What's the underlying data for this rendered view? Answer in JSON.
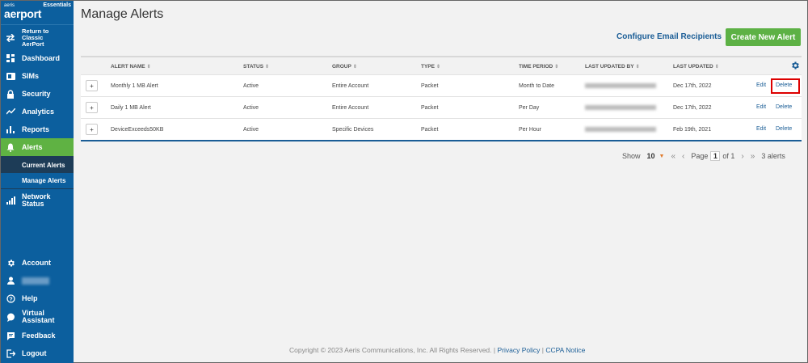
{
  "brand": {
    "small": "aeris",
    "name": "aerport",
    "edition": "Essentials"
  },
  "sidebar": {
    "items": [
      {
        "label": "Return to Classic AerPort",
        "icon": "swap-arrows-icon"
      },
      {
        "label": "Dashboard",
        "icon": "dashboard-icon"
      },
      {
        "label": "SIMs",
        "icon": "sim-icon"
      },
      {
        "label": "Security",
        "icon": "lock-icon"
      },
      {
        "label": "Analytics",
        "icon": "trend-icon"
      },
      {
        "label": "Reports",
        "icon": "bar-chart-icon"
      },
      {
        "label": "Alerts",
        "icon": "bell-icon"
      },
      {
        "label": "Network Status",
        "icon": "signal-icon"
      }
    ],
    "sub_items": [
      {
        "label": "Current Alerts"
      },
      {
        "label": "Manage Alerts"
      }
    ],
    "bottom": [
      {
        "label": "Account",
        "icon": "gear-icon"
      },
      {
        "label": "Help",
        "icon": "help-icon"
      },
      {
        "label": "Virtual Assistant",
        "icon": "chat-icon"
      },
      {
        "label": "Feedback",
        "icon": "feedback-icon"
      },
      {
        "label": "Logout",
        "icon": "logout-icon"
      }
    ]
  },
  "page": {
    "title": "Manage Alerts"
  },
  "actions": {
    "configure": "Configure Email Recipients",
    "create": "Create New Alert"
  },
  "table": {
    "columns": [
      "ALERT NAME",
      "STATUS",
      "GROUP",
      "TYPE",
      "TIME PERIOD",
      "LAST UPDATED BY",
      "LAST UPDATED"
    ],
    "rows": [
      {
        "name": "Monthly 1 MB Alert",
        "status": "Active",
        "group": "Entire Account",
        "type": "Packet",
        "period": "Month to Date",
        "updated": "Dec 17th, 2022",
        "edit": "Edit",
        "delete": "Delete"
      },
      {
        "name": "Daily 1 MB Alert",
        "status": "Active",
        "group": "Entire Account",
        "type": "Packet",
        "period": "Per Day",
        "updated": "Dec 17th, 2022",
        "edit": "Edit",
        "delete": "Delete"
      },
      {
        "name": "DeviceExceeds50KB",
        "status": "Active",
        "group": "Specific Devices",
        "type": "Packet",
        "period": "Per Hour",
        "updated": "Feb 19th, 2021",
        "edit": "Edit",
        "delete": "Delete"
      }
    ]
  },
  "pager": {
    "show": "Show",
    "size": "10",
    "page_label": "Page",
    "page": "1",
    "of": "of 1",
    "count": "3 alerts"
  },
  "footer": {
    "copyright": "Copyright © 2023 Aeris Communications, Inc. All Rights Reserved. |",
    "privacy": "Privacy Policy",
    "sep": "|",
    "ccpa": "CCPA Notice"
  }
}
